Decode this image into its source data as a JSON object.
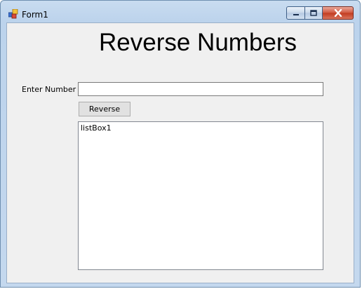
{
  "window": {
    "title": "Form1",
    "icon": "winforms-app-icon",
    "buttons": [
      "minimize-icon",
      "maximize-icon",
      "close-icon"
    ]
  },
  "form": {
    "heading": "Reverse Numbers",
    "number_label": "Enter Number :",
    "number_value": "",
    "reverse_button_label": "Reverse",
    "listbox_items": [
      "listBox1"
    ]
  }
}
